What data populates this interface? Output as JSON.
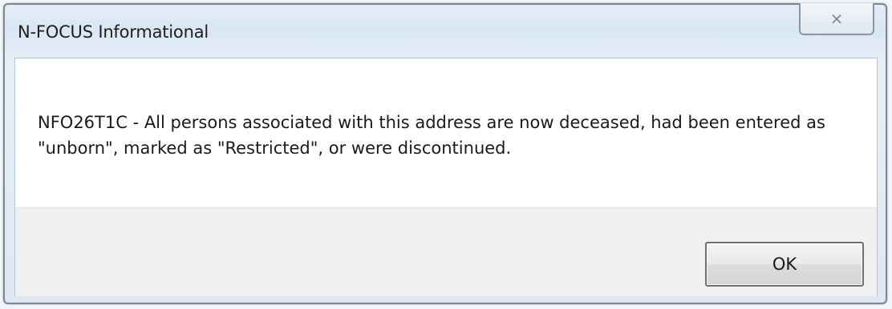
{
  "window": {
    "title": "N-FOCUS Informational"
  },
  "titlebar": {
    "close_glyph": "⨯",
    "close_icon": "close-icon"
  },
  "dialog": {
    "message": "NFO26T1C - All persons associated with this address are now deceased, had been entered as \"unborn\", marked as \"Restricted\", or were discontinued.",
    "ok_label": "OK"
  }
}
